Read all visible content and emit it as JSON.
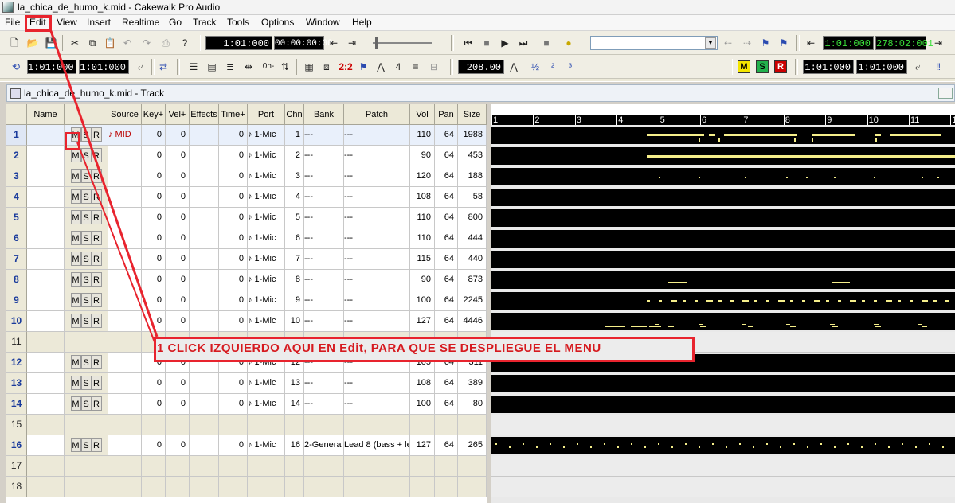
{
  "window": {
    "title": "la_chica_de_humo_k.mid - Cakewalk Pro Audio"
  },
  "menu": [
    "File",
    "Edit",
    "View",
    "Insert",
    "Realtime",
    "Go",
    "Track",
    "Tools",
    "Options",
    "Window",
    "Help"
  ],
  "toolbar1": {
    "now_time": "1:01:000",
    "smpte": "00:00:00:00",
    "sel_start": "1:01:000",
    "sel_end": "278:02:001"
  },
  "toolbar2": {
    "from_time": "1:01:000",
    "thru_time": "1:01:000",
    "tempo": "208.00",
    "punch_in": "1:01:000",
    "punch_out": "1:01:000",
    "zero_label": "0h-",
    "ratio_label": "2:2"
  },
  "track_window": {
    "title": "la_chica_de_humo_k.mid - Track"
  },
  "columns": [
    "Name",
    "Source",
    "Key+",
    "Vel+",
    "Effects",
    "Time+",
    "Port",
    "Chn",
    "Bank",
    "Patch",
    "Vol",
    "Pan",
    "Size"
  ],
  "tracks": [
    {
      "num": "1",
      "name": "",
      "msr": [
        "M",
        "S",
        "R"
      ],
      "source": "♪ MID",
      "key": "0",
      "vel": "0",
      "effects": "",
      "time": "0",
      "port": "♪ 1-Mic",
      "chn": "1",
      "bank": "---",
      "patch": "---",
      "vol": "110",
      "pan": "64",
      "size": "1988"
    },
    {
      "num": "2",
      "name": "",
      "msr": [
        "M",
        "S",
        "R"
      ],
      "source": "",
      "key": "0",
      "vel": "0",
      "effects": "",
      "time": "0",
      "port": "♪ 1-Mic",
      "chn": "2",
      "bank": "---",
      "patch": "---",
      "vol": "90",
      "pan": "64",
      "size": "453"
    },
    {
      "num": "3",
      "name": "",
      "msr": [
        "M",
        "S",
        "R"
      ],
      "source": "",
      "key": "0",
      "vel": "0",
      "effects": "",
      "time": "0",
      "port": "♪ 1-Mic",
      "chn": "3",
      "bank": "---",
      "patch": "---",
      "vol": "120",
      "pan": "64",
      "size": "188"
    },
    {
      "num": "4",
      "name": "",
      "msr": [
        "M",
        "S",
        "R"
      ],
      "source": "",
      "key": "0",
      "vel": "0",
      "effects": "",
      "time": "0",
      "port": "♪ 1-Mic",
      "chn": "4",
      "bank": "---",
      "patch": "---",
      "vol": "108",
      "pan": "64",
      "size": "58"
    },
    {
      "num": "5",
      "name": "",
      "msr": [
        "M",
        "S",
        "R"
      ],
      "source": "",
      "key": "0",
      "vel": "0",
      "effects": "",
      "time": "0",
      "port": "♪ 1-Mic",
      "chn": "5",
      "bank": "---",
      "patch": "---",
      "vol": "110",
      "pan": "64",
      "size": "800"
    },
    {
      "num": "6",
      "name": "",
      "msr": [
        "M",
        "S",
        "R"
      ],
      "source": "",
      "key": "0",
      "vel": "0",
      "effects": "",
      "time": "0",
      "port": "♪ 1-Mic",
      "chn": "6",
      "bank": "---",
      "patch": "---",
      "vol": "110",
      "pan": "64",
      "size": "444"
    },
    {
      "num": "7",
      "name": "",
      "msr": [
        "M",
        "S",
        "R"
      ],
      "source": "",
      "key": "0",
      "vel": "0",
      "effects": "",
      "time": "0",
      "port": "♪ 1-Mic",
      "chn": "7",
      "bank": "---",
      "patch": "---",
      "vol": "115",
      "pan": "64",
      "size": "440"
    },
    {
      "num": "8",
      "name": "",
      "msr": [
        "M",
        "S",
        "R"
      ],
      "source": "",
      "key": "0",
      "vel": "0",
      "effects": "",
      "time": "0",
      "port": "♪ 1-Mic",
      "chn": "8",
      "bank": "---",
      "patch": "---",
      "vol": "90",
      "pan": "64",
      "size": "873"
    },
    {
      "num": "9",
      "name": "",
      "msr": [
        "M",
        "S",
        "R"
      ],
      "source": "",
      "key": "0",
      "vel": "0",
      "effects": "",
      "time": "0",
      "port": "♪ 1-Mic",
      "chn": "9",
      "bank": "---",
      "patch": "---",
      "vol": "100",
      "pan": "64",
      "size": "2245"
    },
    {
      "num": "10",
      "name": "",
      "msr": [
        "M",
        "S",
        "R"
      ],
      "source": "",
      "key": "0",
      "vel": "0",
      "effects": "",
      "time": "0",
      "port": "♪ 1-Mic",
      "chn": "10",
      "bank": "---",
      "patch": "---",
      "vol": "127",
      "pan": "64",
      "size": "4446"
    },
    {
      "num": "11",
      "empty": true
    },
    {
      "num": "12",
      "name": "",
      "msr": [
        "M",
        "S",
        "R"
      ],
      "source": "",
      "key": "0",
      "vel": "0",
      "effects": "",
      "time": "0",
      "port": "♪ 1-Mic",
      "chn": "12",
      "bank": "---",
      "patch": "---",
      "vol": "105",
      "pan": "64",
      "size": "311"
    },
    {
      "num": "13",
      "name": "",
      "msr": [
        "M",
        "S",
        "R"
      ],
      "source": "",
      "key": "0",
      "vel": "0",
      "effects": "",
      "time": "0",
      "port": "♪ 1-Mic",
      "chn": "13",
      "bank": "---",
      "patch": "---",
      "vol": "108",
      "pan": "64",
      "size": "389"
    },
    {
      "num": "14",
      "name": "",
      "msr": [
        "M",
        "S",
        "R"
      ],
      "source": "",
      "key": "0",
      "vel": "0",
      "effects": "",
      "time": "0",
      "port": "♪ 1-Mic",
      "chn": "14",
      "bank": "---",
      "patch": "---",
      "vol": "100",
      "pan": "64",
      "size": "80"
    },
    {
      "num": "15",
      "empty": true
    },
    {
      "num": "16",
      "name": "",
      "msr": [
        "M",
        "S",
        "R"
      ],
      "source": "",
      "key": "0",
      "vel": "0",
      "effects": "",
      "time": "0",
      "port": "♪ 1-Mic",
      "chn": "16",
      "bank": "2-Genera",
      "patch": "Lead 8 (bass + le",
      "vol": "127",
      "pan": "64",
      "size": "265"
    },
    {
      "num": "17",
      "empty": true
    },
    {
      "num": "18",
      "empty": true
    }
  ],
  "ruler": [
    "1",
    "2",
    "3",
    "4",
    "5",
    "6",
    "7",
    "8",
    "9",
    "10",
    "11",
    "1"
  ],
  "annotation": {
    "text": "1 CLICK IZQUIERDO AQUI EN Edit, PARA QUE SE DESPLIEGUE EL MENU",
    "color": "#e8242e"
  },
  "colors": {
    "clip_background": "#000000",
    "note_color": "#f5ee8a",
    "mute_record_red": "#cc0000",
    "solo_green": "#22b14c",
    "meter_yellow": "#f4e600"
  }
}
